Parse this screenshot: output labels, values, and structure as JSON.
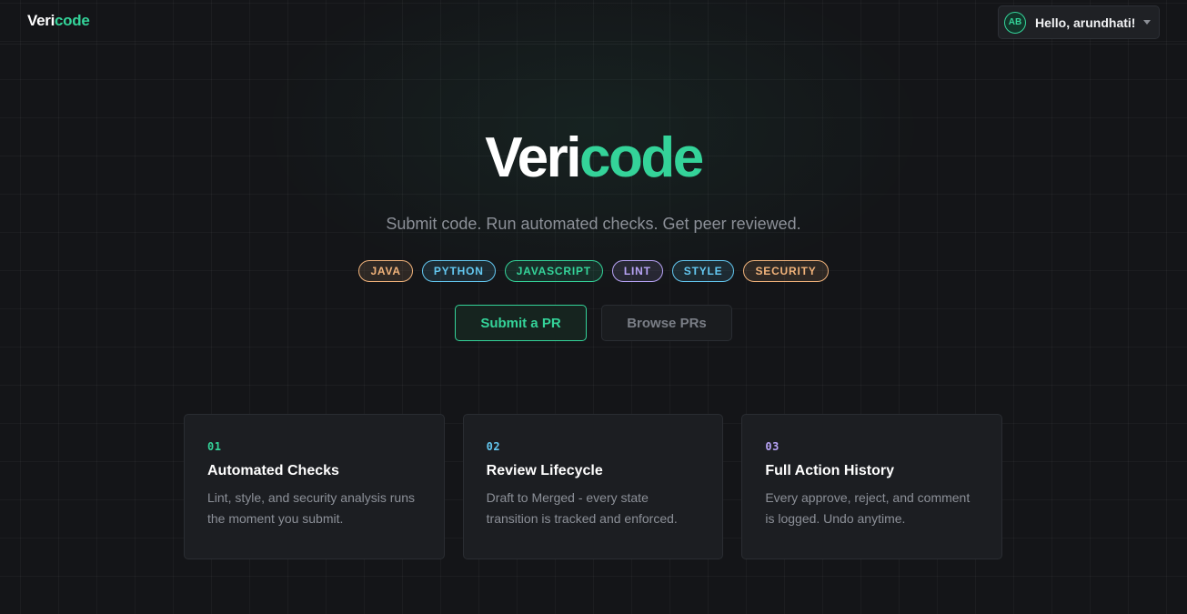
{
  "header": {
    "brand": {
      "part1": "Veri",
      "part2": "code"
    },
    "user": {
      "initials": "AB",
      "greeting": "Hello, arundhati!"
    }
  },
  "hero": {
    "title": {
      "part1": "Veri",
      "part2": "code"
    },
    "tagline": "Submit code. Run automated checks. Get peer reviewed.",
    "tags": [
      {
        "label": "JAVA",
        "color": "#f0b27a"
      },
      {
        "label": "PYTHON",
        "color": "#63c7f0"
      },
      {
        "label": "JAVASCRIPT",
        "color": "#34d399"
      },
      {
        "label": "LINT",
        "color": "#b7a3f5"
      },
      {
        "label": "STYLE",
        "color": "#63c7f0"
      },
      {
        "label": "SECURITY",
        "color": "#f0b27a"
      }
    ],
    "primary_button": "Submit a PR",
    "secondary_button": "Browse PRs"
  },
  "features": [
    {
      "num": "01",
      "num_color": "#34d399",
      "title": "Automated Checks",
      "desc": "Lint, style, and security analysis runs the moment you submit."
    },
    {
      "num": "02",
      "num_color": "#63c7f0",
      "title": "Review Lifecycle",
      "desc": "Draft to Merged - every state transition is tracked and enforced."
    },
    {
      "num": "03",
      "num_color": "#b7a3f5",
      "title": "Full Action History",
      "desc": "Every approve, reject, and comment is logged. Undo anytime."
    }
  ],
  "colors": {
    "accent": "#34d399",
    "background": "#141518"
  }
}
